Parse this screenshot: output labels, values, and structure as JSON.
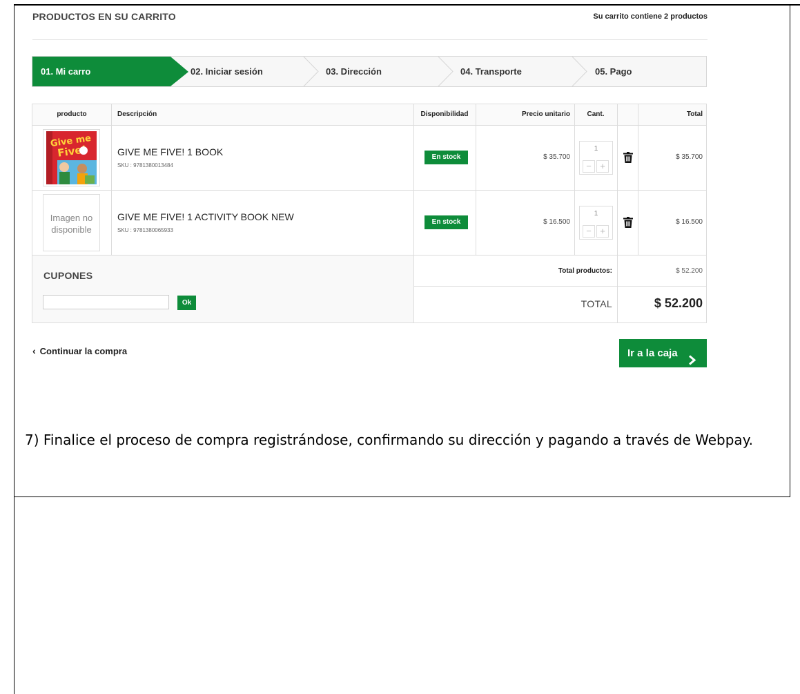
{
  "header": {
    "title": "PRODUCTOS EN SU CARRITO",
    "count_text": "Su carrito contiene 2 productos"
  },
  "steps": [
    {
      "label": "01. Mi carro",
      "active": true
    },
    {
      "label": "02. Iniciar sesión",
      "active": false
    },
    {
      "label": "03. Dirección",
      "active": false
    },
    {
      "label": "04. Transporte",
      "active": false
    },
    {
      "label": "05. Pago",
      "active": false
    }
  ],
  "table": {
    "columns": [
      "producto",
      "Descripción",
      "Disponibilidad",
      "Precio unitario",
      "Cant.",
      "",
      "Total"
    ],
    "rows": [
      {
        "name": "GIVE ME FIVE! 1 BOOK",
        "sku": "SKU : 9781380013484",
        "availability": "En stock",
        "unit_price": "$ 35.700",
        "qty": "1",
        "total": "$ 35.700",
        "image": "cover"
      },
      {
        "name": "GIVE ME FIVE! 1 ACTIVITY BOOK NEW",
        "sku": "SKU : 9781380065933",
        "availability": "En stock",
        "unit_price": "$ 16.500",
        "qty": "1",
        "total": "$ 16.500",
        "image_placeholder": "Imagen no disponible"
      }
    ]
  },
  "coupons": {
    "title": "CUPONES",
    "input_value": "",
    "button_label": "Ok"
  },
  "totals": {
    "products_label": "Total productos:",
    "products_value": "$ 52.200",
    "grand_label": "TOTAL",
    "grand_value": "$ 52.200"
  },
  "actions": {
    "continue_label": "Continuar la compra",
    "checkout_label": "Ir a la caja"
  },
  "instruction": "7) Finalice el proceso de compra registrándose, confirmando su dirección y pagando a través de Webpay.",
  "colors": {
    "accent": "#0e8c3a"
  },
  "icons": [
    "chevron-left-icon",
    "chevron-right-icon",
    "trash-icon",
    "minus-icon",
    "plus-icon"
  ]
}
